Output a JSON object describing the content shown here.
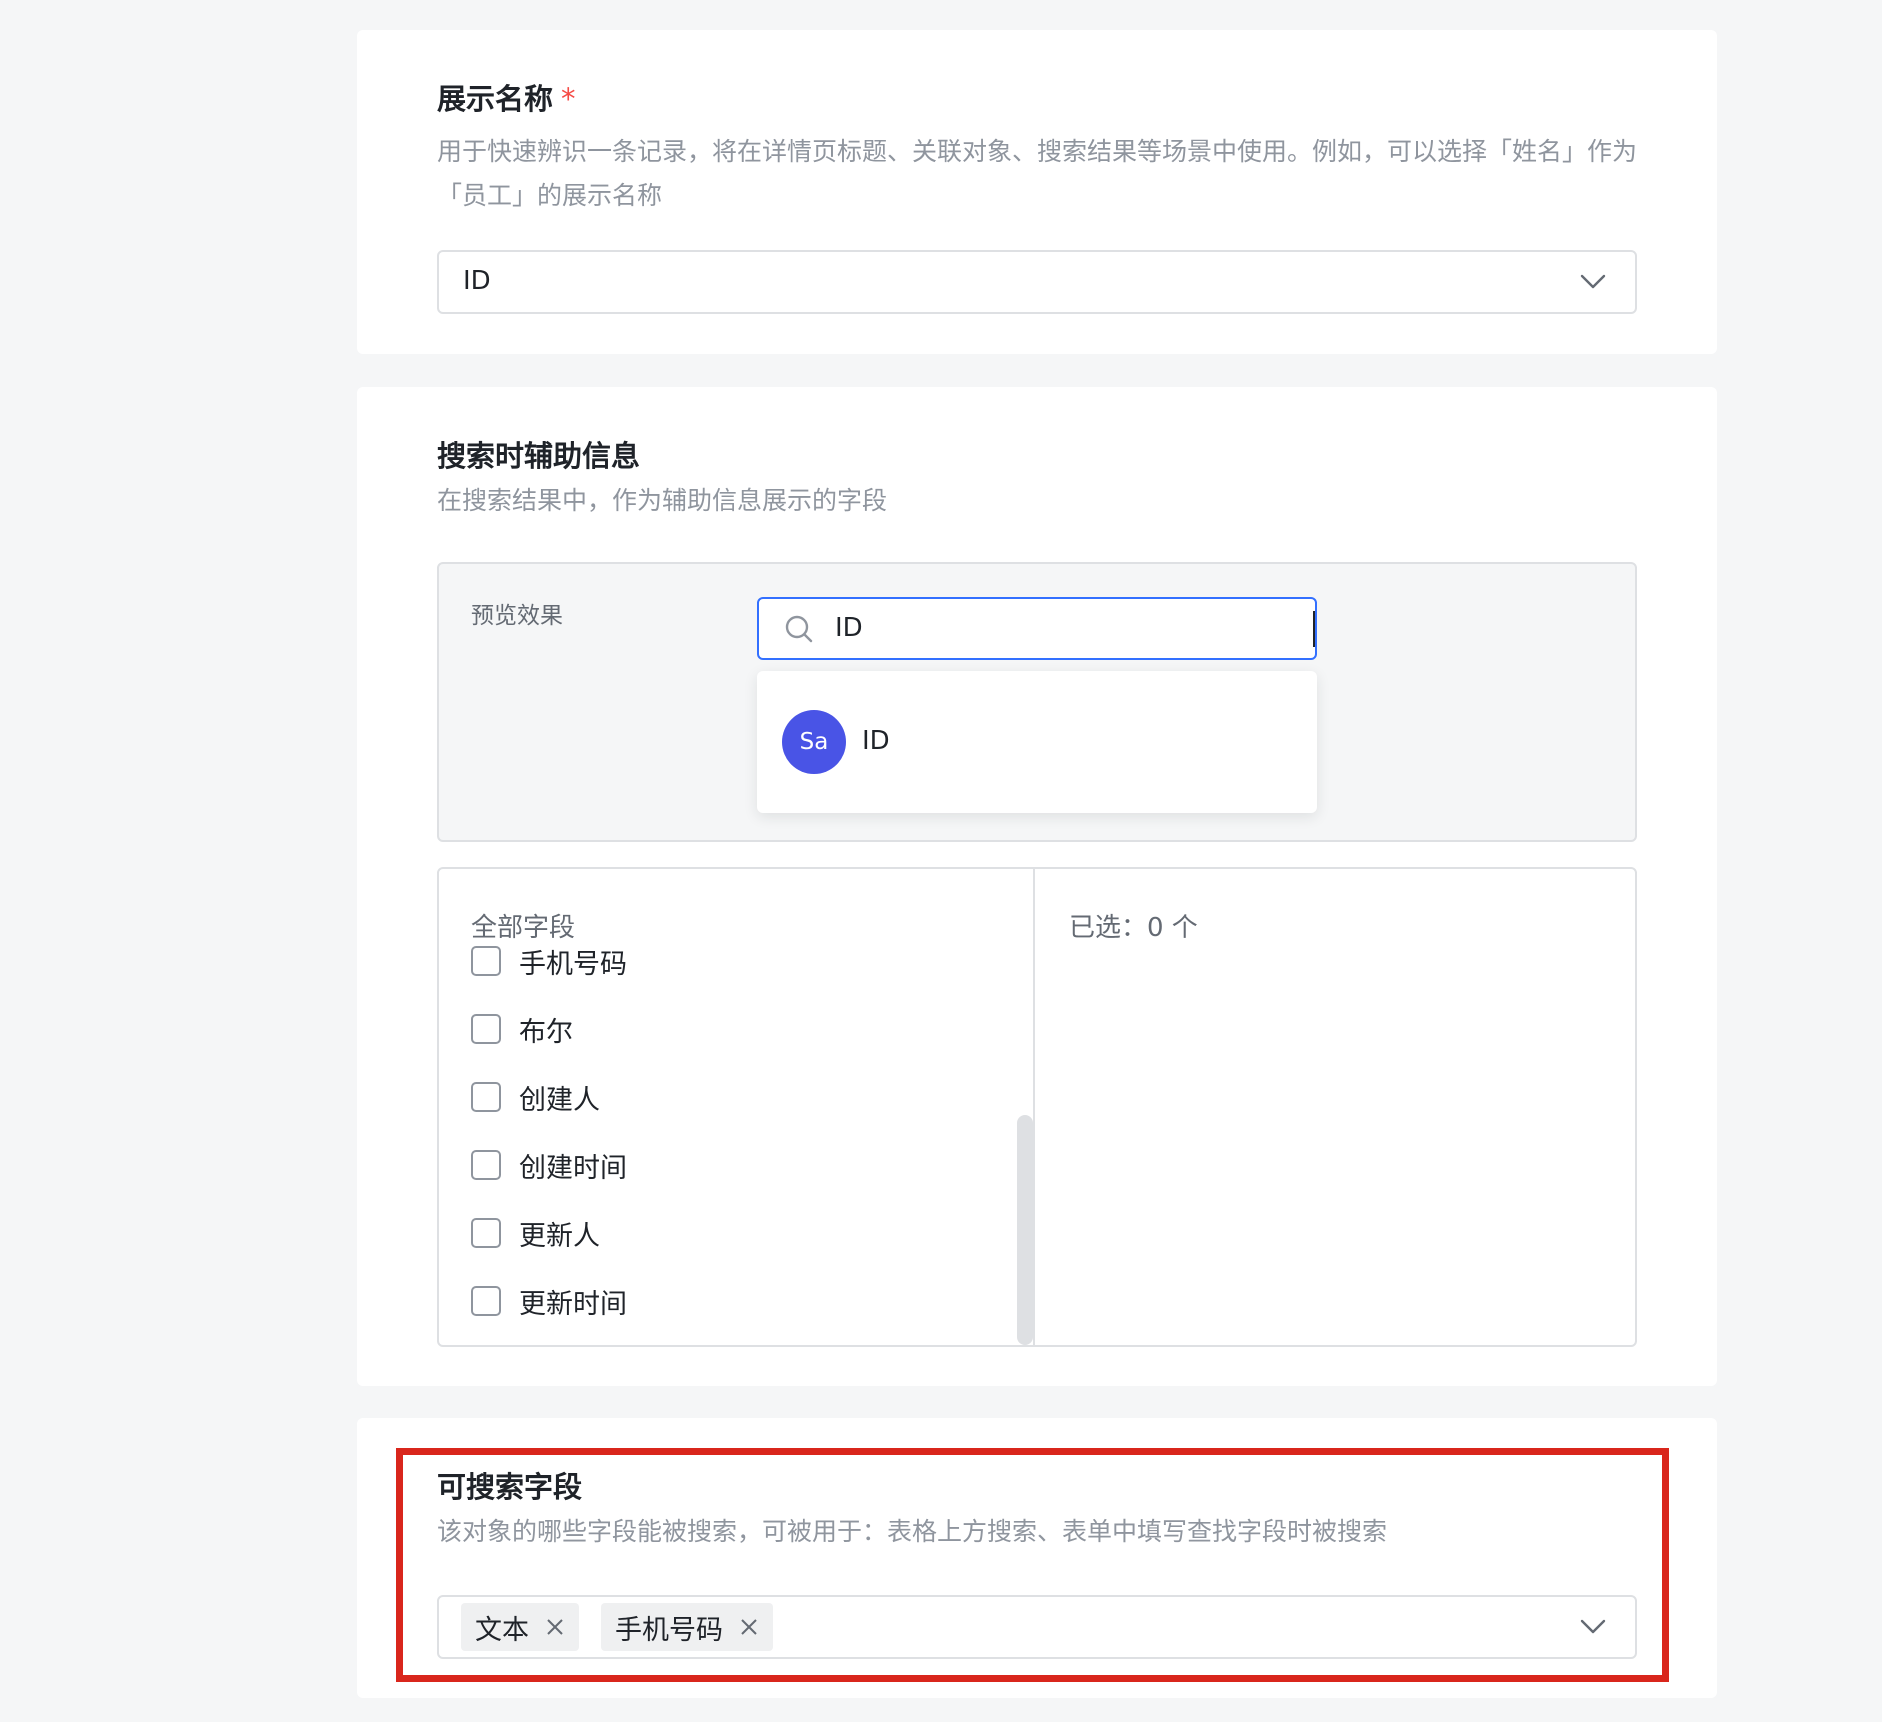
{
  "display_name": {
    "title": "展示名称",
    "required_mark": "*",
    "description": "用于快速辨识一条记录，将在详情页标题、关联对象、搜索结果等场景中使用。例如，可以选择「姓名」作为「员工」的展示名称",
    "select_value": "ID"
  },
  "search_aux": {
    "title": "搜索时辅助信息",
    "description": "在搜索结果中，作为辅助信息展示的字段",
    "preview": {
      "label": "预览效果",
      "search_value": "ID",
      "result": {
        "avatar_text": "Sa",
        "label": "ID"
      }
    },
    "transfer": {
      "all_fields_label": "全部字段",
      "selected_label": "已选：0 个",
      "fields": [
        "手机号码",
        "布尔",
        "创建人",
        "创建时间",
        "更新人",
        "更新时间"
      ]
    }
  },
  "searchable_fields": {
    "title": "可搜索字段",
    "description": "该对象的哪些字段能被搜索，可被用于：表格上方搜索、表单中填写查找字段时被搜索",
    "tags": [
      "文本",
      "手机号码"
    ]
  },
  "colors": {
    "accent": "#3370ff",
    "avatar": "#4954e6",
    "highlight": "#d9261c",
    "required": "#f54a45"
  }
}
